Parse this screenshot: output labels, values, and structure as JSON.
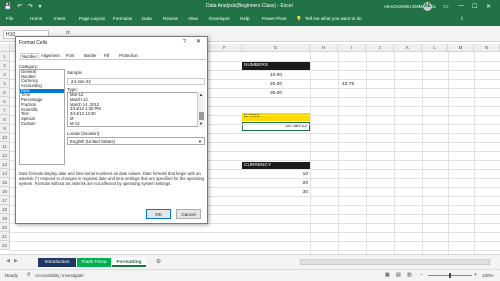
{
  "app": {
    "quick_access": "💾 ↶ ↷ ▾",
    "title": "Data Analysis(Beginners Class)  -  Excel",
    "user": "AKACHUKWU EMMANUEL",
    "avatar_initials": "AE",
    "brand_color": "#217346"
  },
  "ribbon": {
    "tabs": [
      "File",
      "Home",
      "Insert",
      "Page Layout",
      "Formulas",
      "Data",
      "Review",
      "View",
      "Developer",
      "Help",
      "Power Pivot",
      "Tell me what you want to do"
    ]
  },
  "formula_bar": {
    "name_box": "H10",
    "fx": "fx"
  },
  "sheet": {
    "columns": [
      "A",
      "B",
      "C",
      "D",
      "E",
      "F",
      "G",
      "H",
      "I",
      "J",
      "K",
      "L",
      "M",
      "N",
      "O"
    ],
    "rows": [
      "1",
      "2",
      "3",
      "4",
      "5",
      "6",
      "7",
      "8",
      "9",
      "10",
      "11",
      "12",
      "13",
      "14",
      "15",
      "16",
      "17",
      "18",
      "19",
      "20",
      "21",
      "22"
    ],
    "numbers_header": "NUMBERS",
    "numbers": [
      "10.00",
      "20.00",
      "30.00"
    ],
    "side_value": "43.79",
    "dates_header": "DATES",
    "date_value": "24-Jan-22",
    "currency_header": "CURRENCY",
    "currency": [
      "10",
      "20",
      "30"
    ]
  },
  "dialog": {
    "title": "Format Cells",
    "help": "?",
    "close": "✕",
    "tabs": [
      "Number",
      "Alignment",
      "Font",
      "Border",
      "Fill",
      "Protection"
    ],
    "category_label": "Category:",
    "categories": [
      "General",
      "Number",
      "Currency",
      "Accounting",
      "Date",
      "Time",
      "Percentage",
      "Fraction",
      "Scientific",
      "Text",
      "Special",
      "Custom"
    ],
    "selected_category": "Date",
    "sample_label": "Sample",
    "sample_value": "24-Jan-22",
    "type_label": "Type:",
    "types": [
      "Mar-12",
      "March-12",
      "March 14, 2012",
      "3/14/12 1:30 PM",
      "3/14/12 13:30",
      "M",
      "M-12"
    ],
    "locale_label": "Locale (location):",
    "locale_value": "English (United States)",
    "description": "Date formats display date and time serial numbers as date values.  Date formats that begin with an asterisk (*) respond to changes in regional date and time settings that are specified for the operating system. Formats without an asterisk are not affected by operating system settings.",
    "ok": "OK",
    "cancel": "Cancel"
  },
  "sheet_tabs": {
    "items": [
      {
        "label": "Introduction",
        "color": "#1f3864"
      },
      {
        "label": "Flash Fiona",
        "color": "#00b050"
      },
      {
        "label": "Formatting",
        "color": "#ffffff"
      }
    ],
    "add": "⊕"
  },
  "status": {
    "ready": "Ready",
    "accessibility": "Accessibility: Investigate",
    "zoom": "100%"
  }
}
